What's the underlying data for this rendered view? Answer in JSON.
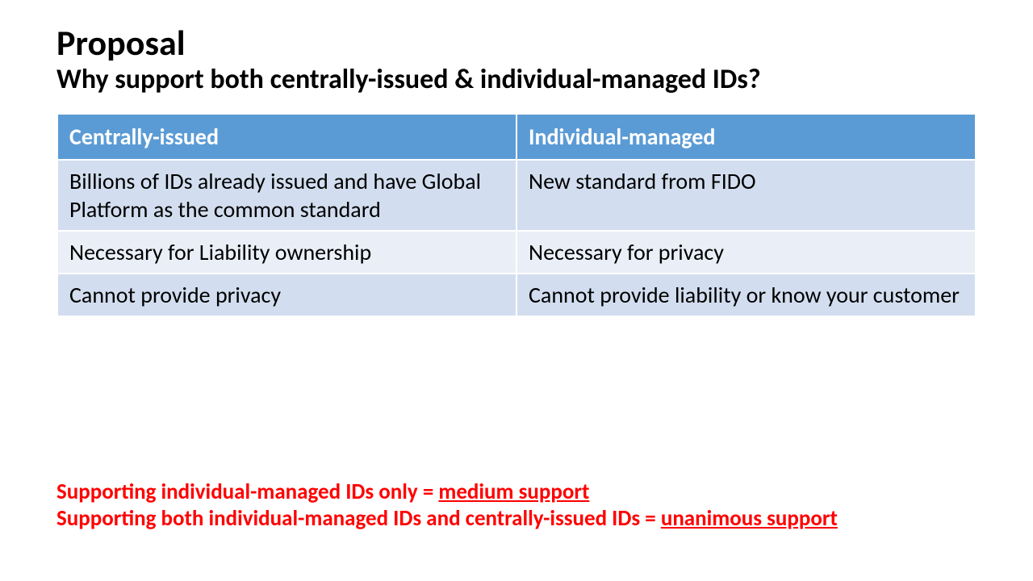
{
  "title": "Proposal",
  "subtitle": "Why support both centrally-issued & individual-managed IDs?",
  "table": {
    "headers": [
      "Centrally-issued",
      "Individual-managed"
    ],
    "rows": [
      [
        "Billions of IDs already issued and have Global Platform as the common standard",
        "New standard from FIDO"
      ],
      [
        "Necessary for Liability ownership",
        "Necessary for privacy"
      ],
      [
        "Cannot provide privacy",
        "Cannot provide liability or know your customer"
      ]
    ]
  },
  "conclusions": [
    {
      "prefix": "Supporting individual-managed IDs only = ",
      "emph": "medium support"
    },
    {
      "prefix": "Supporting both individual-managed IDs and centrally-issued IDs = ",
      "emph": "unanimous support"
    }
  ]
}
